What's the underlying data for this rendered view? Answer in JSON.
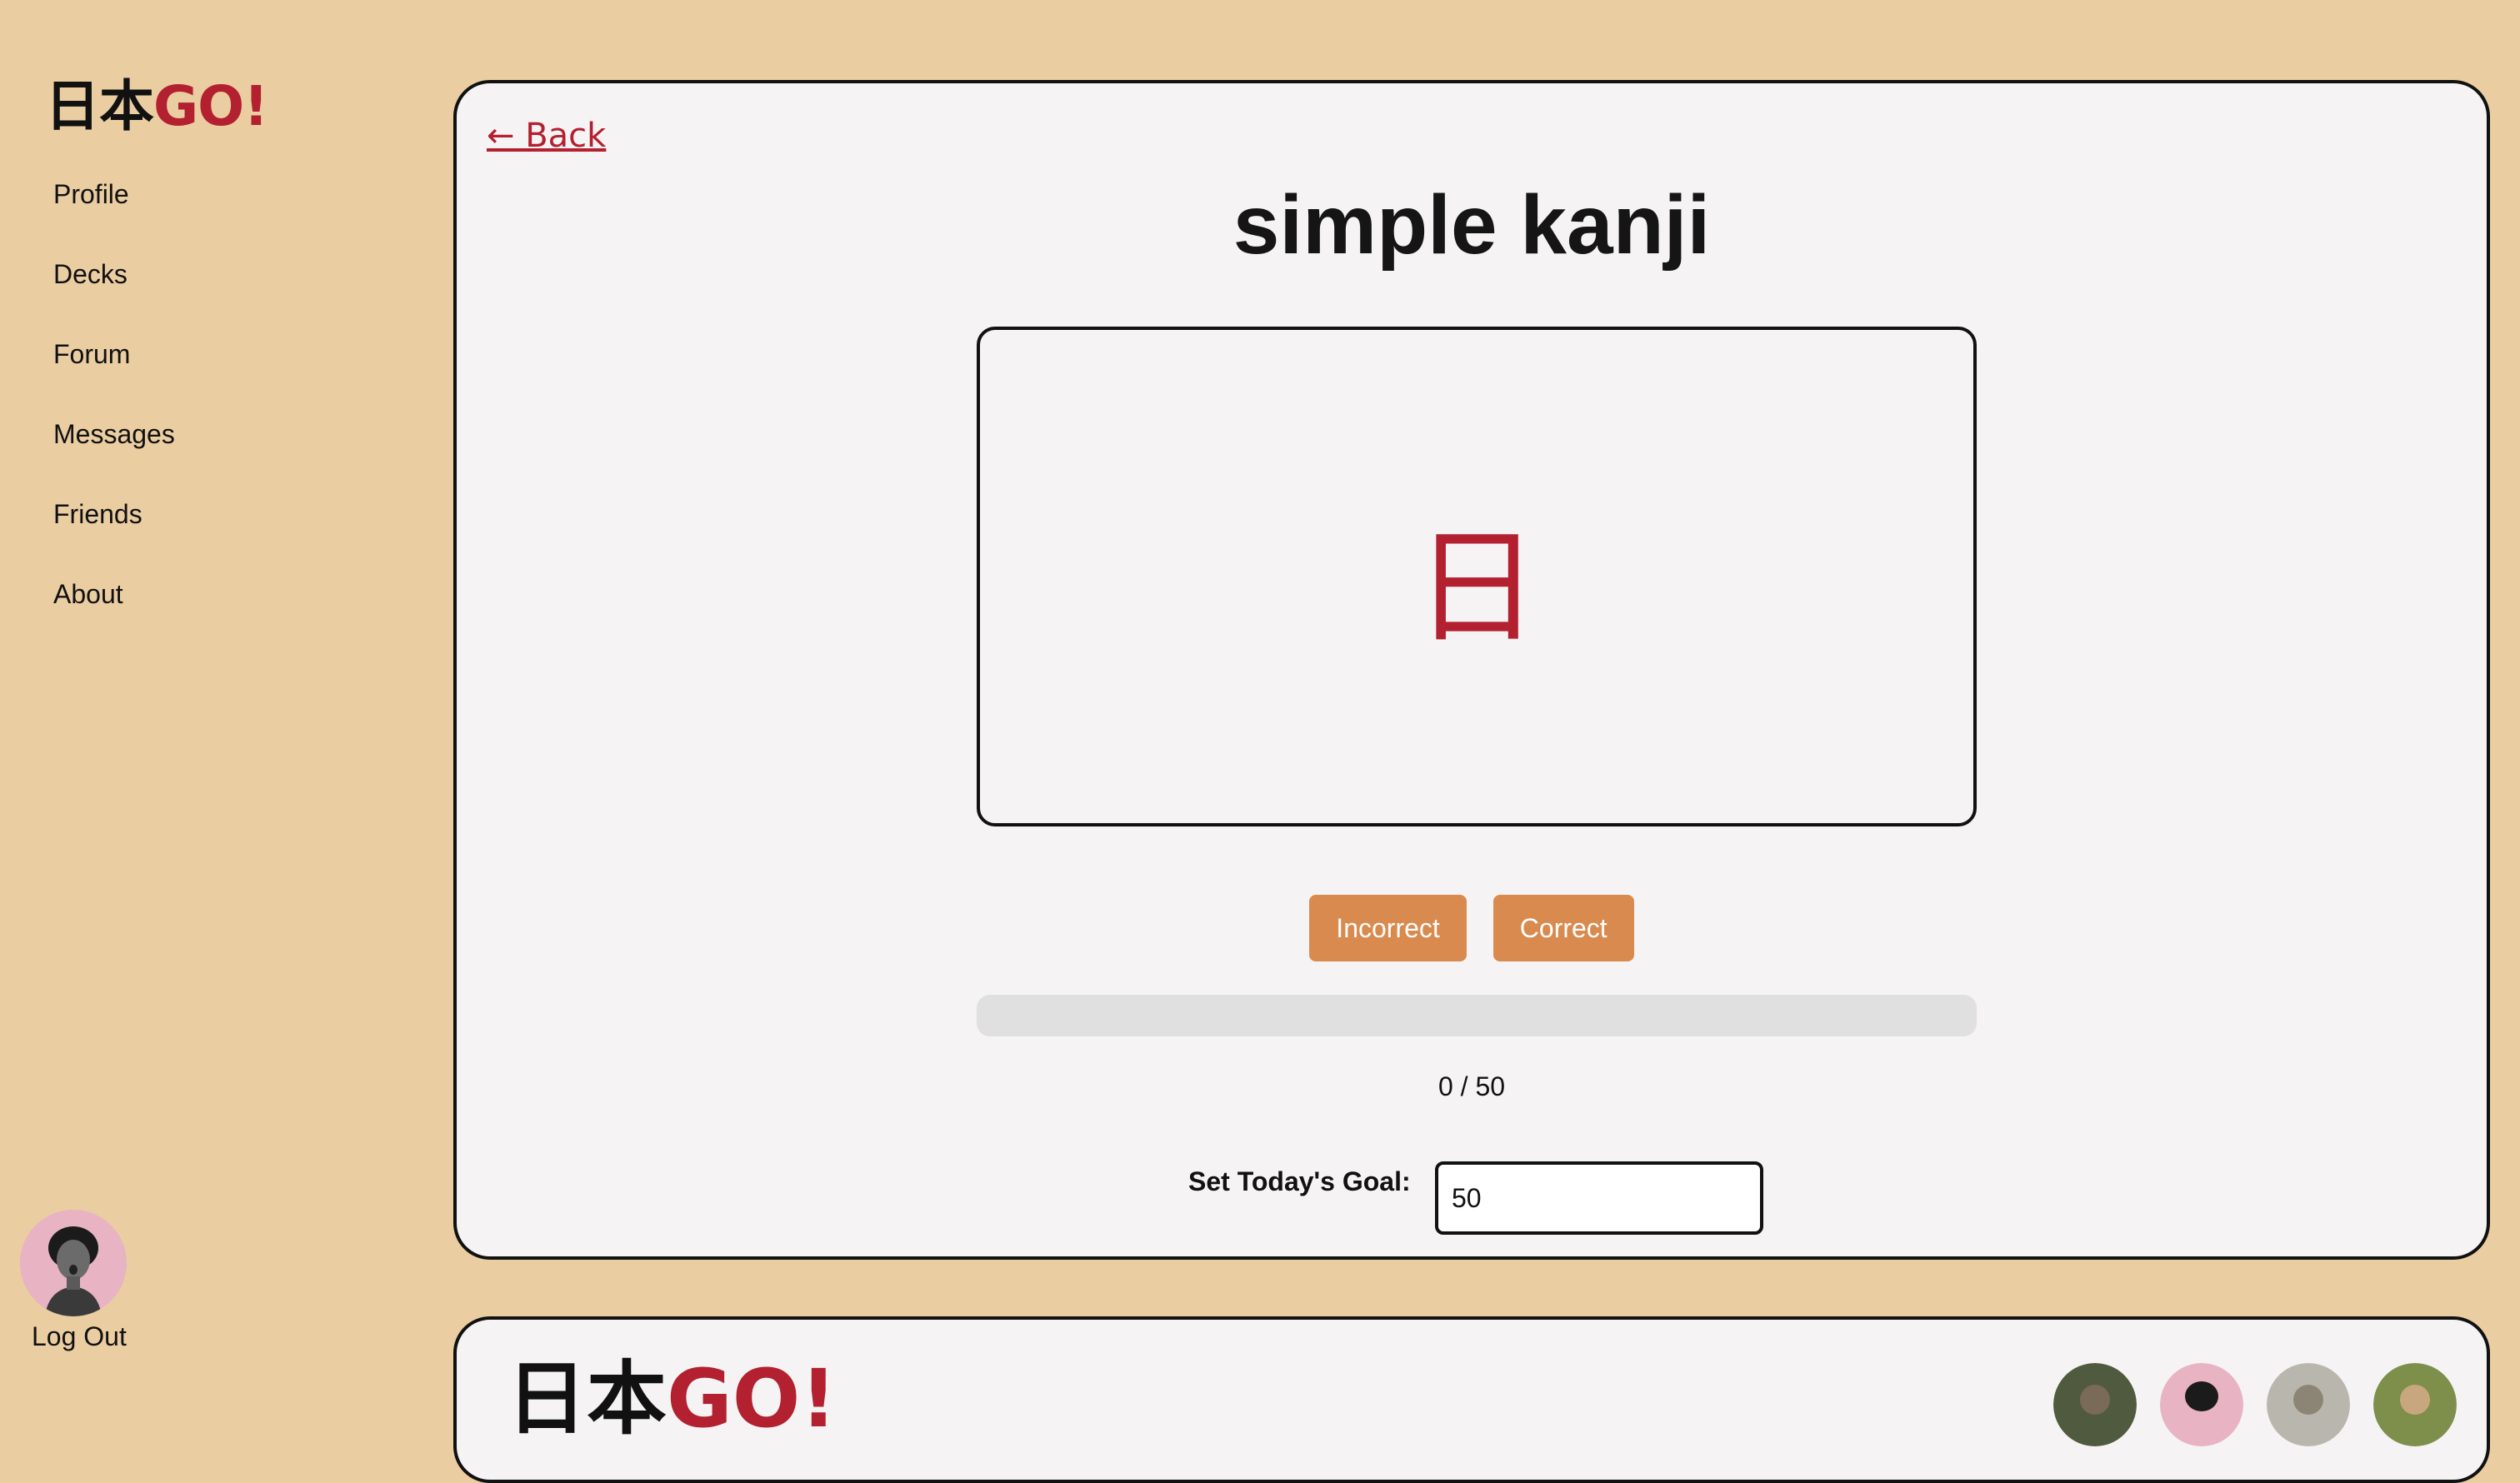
{
  "brand": {
    "jp": "日本",
    "go": "GO!"
  },
  "sidebar": {
    "items": [
      {
        "label": "Profile"
      },
      {
        "label": "Decks"
      },
      {
        "label": "Forum"
      },
      {
        "label": "Messages"
      },
      {
        "label": "Friends"
      },
      {
        "label": "About"
      }
    ],
    "logout_label": "Log Out"
  },
  "study": {
    "back_label": "← Back",
    "deck_title": "simple kanji",
    "card_front": "日",
    "incorrect_label": "Incorrect",
    "correct_label": "Correct",
    "progress_text": "0 / 50",
    "progress_fraction": 0,
    "goal_label": "Set Today's Goal:",
    "goal_value": "50"
  },
  "colors": {
    "background": "#ebcda2",
    "accent_red": "#b3202f",
    "button_orange": "#d98a4e",
    "card_bg": "#f5f3f4"
  },
  "footer_card": {
    "friend_avatars": [
      {
        "icon": "friend-avatar-icon"
      },
      {
        "icon": "friend-avatar-icon"
      },
      {
        "icon": "friend-avatar-icon"
      },
      {
        "icon": "friend-avatar-icon"
      }
    ]
  }
}
